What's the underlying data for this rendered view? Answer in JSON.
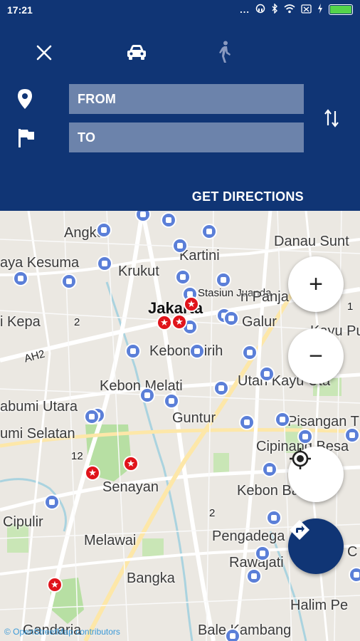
{
  "status_bar": {
    "time": "17:21",
    "dots": "...",
    "battery_level": 1.0,
    "battery_color": "#54d44b"
  },
  "header": {
    "bg_color": "#103575",
    "from_placeholder": "FROM",
    "to_placeholder": "TO",
    "get_directions_label": "GET DIRECTIONS",
    "modes": [
      "car",
      "walk"
    ],
    "selected_mode": "car"
  },
  "map": {
    "labels": {
      "angke": "Angke",
      "danau_sunter": "Danau Sunt",
      "kartini": "Kartini",
      "jaya_kesuma": "aya Kesuma",
      "krukut": "Krukut",
      "stasiun_juanda": "Stasiun Juanda",
      "jakarta": "Jakarta",
      "pinang": "n Panja",
      "kepa": "i Kepa",
      "galur": "Galur",
      "kayu_putih": "Kayu Pu",
      "kebon_sirih": "Kebon Sirih",
      "kebon_melati": "Kebon Melati",
      "utan_kayu": "Utan Kayu Uta",
      "sukabumi_utara": "abumi Utara",
      "guntur": "Guntur",
      "pisangan": "Pisangan T",
      "sukabumi_selatan": "umi Selatan",
      "cipinang": "Cipinang Besa",
      "senayan": "Senayan",
      "kebon_baru": "Kebon Ba",
      "cipulir": "Cipulir",
      "melawai": "Melawai",
      "pengadegan": "Pengadega",
      "rawajati": "Rawajati",
      "bangka": "Bangka",
      "halim": "Halim Pe",
      "gandaria": "Gandaria",
      "bale_kambang": "Bale Kambang",
      "road_ah2": "AH2",
      "road_2a": "2",
      "road_2b": "2",
      "road_12": "12",
      "road_1": "1",
      "road_c": "C"
    },
    "attribution": "© OpenStreetMap contributors"
  },
  "controls": {
    "zoom_in": "+",
    "zoom_out": "−"
  }
}
